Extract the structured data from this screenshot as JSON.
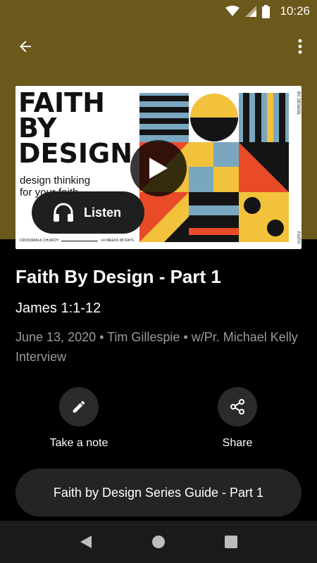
{
  "status_bar": {
    "time": "10:26",
    "icons": [
      "wifi-icon",
      "cellular-signal-icon",
      "battery-icon"
    ]
  },
  "toolbar": {
    "back_icon": "arrow-back-icon",
    "menu_icon": "more-vert-icon"
  },
  "artwork": {
    "title": "FAITH\nBY\nDESIGN",
    "subtitle": "design thinking\nfor your faith",
    "footer_left": "CROSSWALK CHURCH",
    "footer_right": "14 WEEKS 98 DAYS",
    "side_text_top": "BY DESIGN",
    "side_text_bottom": "FAITH"
  },
  "player": {
    "play_icon": "play-icon",
    "listen_label": "Listen",
    "listen_icon": "headphones-icon"
  },
  "sermon": {
    "title": "Faith By Design - Part 1",
    "passage": "James 1:1-12",
    "meta": "June 13, 2020 • Tim Gillespie • w/Pr. Michael Kelly Interview"
  },
  "actions": {
    "note": {
      "label": "Take a note",
      "icon": "pencil-icon"
    },
    "share": {
      "label": "Share",
      "icon": "share-icon"
    }
  },
  "series_guide": {
    "label": "Faith by Design Series Guide - Part 1"
  },
  "nav": {
    "back": "nav-back-icon",
    "home": "nav-home-icon",
    "recents": "nav-recents-icon"
  },
  "colors": {
    "header_band": "#6b581b",
    "background": "#000000",
    "pill": "#1f1f1f",
    "art_red": "#e94a28",
    "art_blue": "#7aa7c0",
    "art_yellow": "#f2c23c",
    "art_black": "#141414"
  }
}
